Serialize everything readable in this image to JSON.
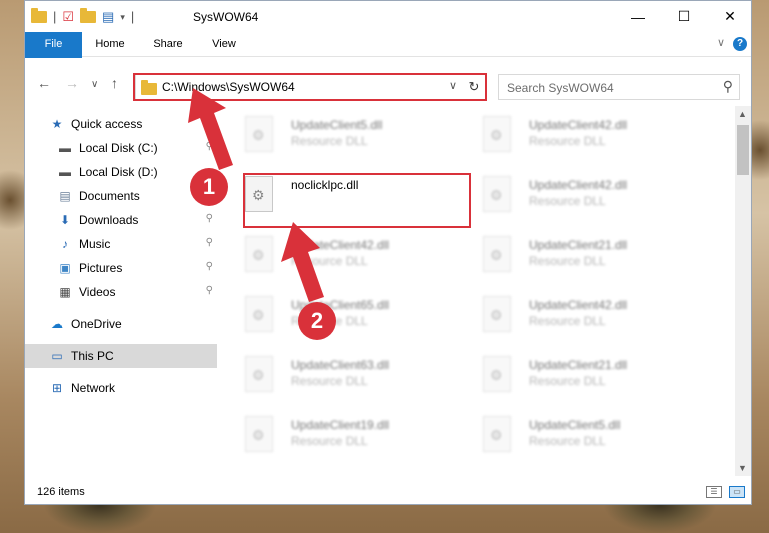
{
  "window": {
    "title": "SysWOW64",
    "controls": {
      "minimize": "—",
      "maximize": "☐",
      "close": "✕"
    }
  },
  "ribbon": {
    "tabs": [
      {
        "label": "File"
      },
      {
        "label": "Home"
      },
      {
        "label": "Share"
      },
      {
        "label": "View"
      }
    ],
    "help": "?"
  },
  "nav": {
    "address": "C:\\Windows\\SysWOW64",
    "search_placeholder": "Search SysWOW64"
  },
  "sidebar": {
    "items": [
      {
        "label": "Quick access",
        "icon": "star-icon",
        "pinned": false
      },
      {
        "label": "Local Disk (C:)",
        "icon": "drive-icon",
        "pinned": true
      },
      {
        "label": "Local Disk (D:)",
        "icon": "drive-icon",
        "pinned": false
      },
      {
        "label": "Documents",
        "icon": "documents-icon",
        "pinned": true
      },
      {
        "label": "Downloads",
        "icon": "downloads-icon",
        "pinned": true
      },
      {
        "label": "Music",
        "icon": "music-icon",
        "pinned": true
      },
      {
        "label": "Pictures",
        "icon": "pictures-icon",
        "pinned": true
      },
      {
        "label": "Videos",
        "icon": "videos-icon",
        "pinned": true
      },
      {
        "label": "OneDrive",
        "icon": "cloud-icon",
        "pinned": false
      },
      {
        "label": "This PC",
        "icon": "computer-icon",
        "pinned": false,
        "selected": true
      },
      {
        "label": "Network",
        "icon": "network-icon",
        "pinned": false
      }
    ]
  },
  "files": [
    {
      "name": "UpdateClient5.dll",
      "type": "Resource DLL",
      "blurred": true
    },
    {
      "name": "UpdateClient42.dll",
      "type": "Resource DLL",
      "blurred": true
    },
    {
      "name": "noclicklpc.dll",
      "type": "",
      "blurred": false
    },
    {
      "name": "UpdateClient42.dll",
      "type": "Resource DLL",
      "blurred": true
    },
    {
      "name": "UpdateClient42.dll",
      "type": "Resource DLL",
      "blurred": true
    },
    {
      "name": "UpdateClient21.dll",
      "type": "Resource DLL",
      "blurred": true
    },
    {
      "name": "UpdateClient65.dll",
      "type": "Resource DLL",
      "blurred": true
    },
    {
      "name": "UpdateClient42.dll",
      "type": "Resource DLL",
      "blurred": true
    },
    {
      "name": "UpdateClient63.dll",
      "type": "Resource DLL",
      "blurred": true
    },
    {
      "name": "UpdateClient21.dll",
      "type": "Resource DLL",
      "blurred": true
    },
    {
      "name": "UpdateClient19.dll",
      "type": "Resource DLL",
      "blurred": true
    },
    {
      "name": "UpdateClient5.dll",
      "type": "Resource DLL",
      "blurred": true
    }
  ],
  "status": {
    "count": "126 items"
  },
  "annotations": {
    "step1": "1",
    "step2": "2",
    "color": "#d9313a"
  }
}
